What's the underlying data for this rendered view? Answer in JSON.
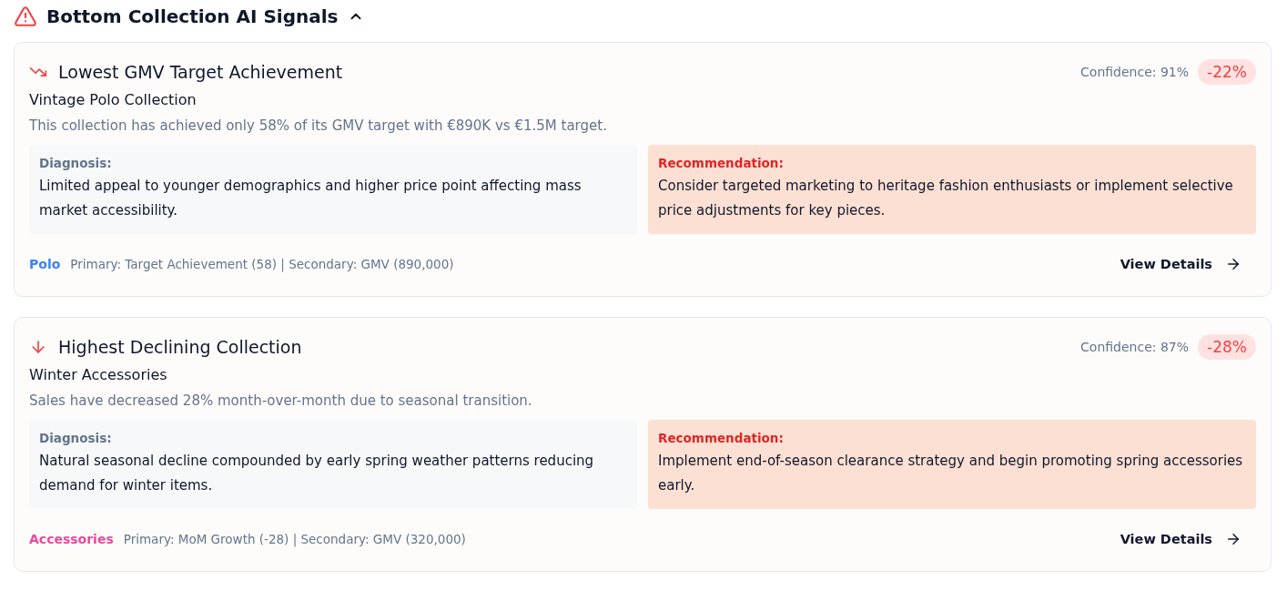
{
  "section": {
    "title": "Bottom Collection AI Signals",
    "expanded": true
  },
  "signals": [
    {
      "kind": "trend",
      "title": "Lowest GMV Target Achievement",
      "confidence": "Confidence: 91%",
      "change": "-22%",
      "collection": "Vintage Polo Collection",
      "summary": "This collection has achieved only 58% of its GMV target with €890K vs €1.5M target.",
      "diagnosis_label": "Diagnosis:",
      "diagnosis": "Limited appeal to younger demographics and higher price point affecting mass market accessibility.",
      "recommendation_label": "Recommendation:",
      "recommendation": "Consider targeted marketing to heritage fashion enthusiasts or implement selective price adjustments for key pieces.",
      "category": "Polo",
      "color": "#3b82f6",
      "metrics": "Primary: Target Achievement (58) | Secondary: GMV (890,000)",
      "action": "View Details"
    },
    {
      "kind": "decline",
      "title": "Highest Declining Collection",
      "confidence": "Confidence: 87%",
      "change": "-28%",
      "collection": "Winter Accessories",
      "summary": "Sales have decreased 28% month-over-month due to seasonal transition.",
      "diagnosis_label": "Diagnosis:",
      "diagnosis": "Natural seasonal decline compounded by early spring weather patterns reducing demand for winter items.",
      "recommendation_label": "Recommendation:",
      "recommendation": "Implement end-of-season clearance strategy and begin promoting spring accessories early.",
      "category": "Accessories",
      "color": "#ec4899",
      "metrics": "Primary: MoM Growth (-28) | Secondary: GMV (320,000)",
      "action": "View Details"
    }
  ]
}
